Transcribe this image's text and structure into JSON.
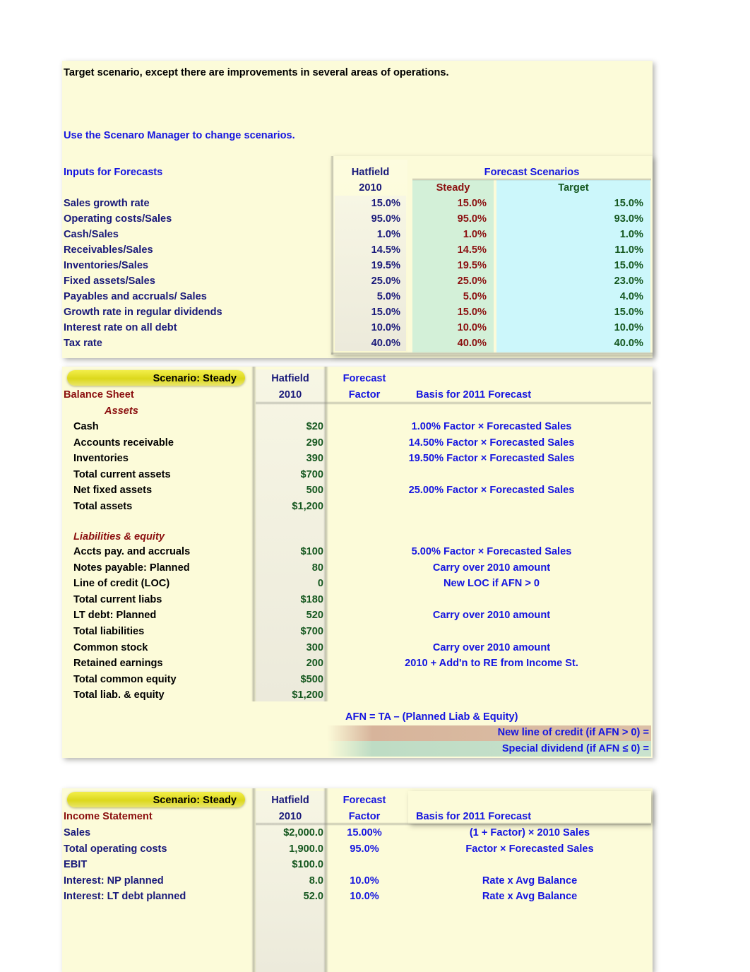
{
  "header": {
    "intro_note": "Target scenario, except there are improvements in several areas of operations.",
    "instruction": "Use the Scenaro Manager to change scenarios."
  },
  "inputs": {
    "title": "Inputs for Forecasts",
    "col_hatfield_line1": "Hatfield",
    "col_hatfield_line2": "2010",
    "group_header": "Forecast Scenarios",
    "col_steady": "Steady",
    "col_target": "Target",
    "rows": [
      {
        "label": "Sales growth rate",
        "hatfield": "15.0%",
        "steady": "15.0%",
        "target": "15.0%"
      },
      {
        "label": "Operating costs/Sales",
        "hatfield": "95.0%",
        "steady": "95.0%",
        "target": "93.0%"
      },
      {
        "label": "Cash/Sales",
        "hatfield": "1.0%",
        "steady": "1.0%",
        "target": "1.0%"
      },
      {
        "label": "Receivables/Sales",
        "hatfield": "14.5%",
        "steady": "14.5%",
        "target": "11.0%"
      },
      {
        "label": "Inventories/Sales",
        "hatfield": "19.5%",
        "steady": "19.5%",
        "target": "15.0%"
      },
      {
        "label": "Fixed assets/Sales",
        "hatfield": "25.0%",
        "steady": "25.0%",
        "target": "23.0%"
      },
      {
        "label": "Payables and accruals/ Sales",
        "hatfield": "5.0%",
        "steady": "5.0%",
        "target": "4.0%"
      },
      {
        "label": "Growth rate in regular dividends",
        "hatfield": "15.0%",
        "steady": "15.0%",
        "target": "15.0%"
      },
      {
        "label": "Interest rate on all debt",
        "hatfield": "10.0%",
        "steady": "10.0%",
        "target": "10.0%"
      },
      {
        "label": "Tax rate",
        "hatfield": "40.0%",
        "steady": "40.0%",
        "target": "40.0%"
      }
    ]
  },
  "balance_sheet": {
    "scenario_tag": "Scenario: Steady",
    "col_hatfield_line1": "Hatfield",
    "col_hatfield_line2": "2010",
    "col_factor_line1": "Forecast",
    "col_factor_line2": "Factor",
    "statement_title": "Balance Sheet",
    "basis_header": "Basis for 2011 Forecast",
    "assets_header": "Assets",
    "liabilities_header": "Liabilities & equity",
    "rows": [
      {
        "label": "Cash",
        "value": "$20",
        "basis": "1.00% Factor × Forecasted Sales"
      },
      {
        "label": "Accounts receivable",
        "value": "290",
        "basis": "14.50% Factor × Forecasted Sales"
      },
      {
        "label": "Inventories",
        "value": "390",
        "basis": "19.50% Factor × Forecasted Sales"
      },
      {
        "label": "Total current assets",
        "value": "$700",
        "basis": ""
      },
      {
        "label": "Net fixed assets",
        "value": "500",
        "basis": "25.00% Factor × Forecasted Sales"
      },
      {
        "label": "Total assets",
        "value": "$1,200",
        "basis": ""
      }
    ],
    "liab_rows": [
      {
        "label": "Accts pay. and accruals",
        "value": "$100",
        "basis": "5.00% Factor × Forecasted Sales"
      },
      {
        "label": "Notes payable: Planned",
        "value": "80",
        "basis": "Carry over 2010 amount"
      },
      {
        "label": "Line of credit (LOC)",
        "value": "0",
        "basis": "New LOC if AFN > 0"
      },
      {
        "label": "Total current liabs",
        "value": "$180",
        "basis": ""
      },
      {
        "label": "LT debt: Planned",
        "value": "520",
        "basis": "Carry over 2010 amount"
      },
      {
        "label": "Total liabilities",
        "value": "$700",
        "basis": ""
      },
      {
        "label": "Common stock",
        "value": "300",
        "basis": "Carry over 2010 amount"
      },
      {
        "label": "Retained earnings",
        "value": "200",
        "basis": "2010 + Add'n to RE from Income St."
      },
      {
        "label": "Total common equity",
        "value": "$500",
        "basis": ""
      },
      {
        "label": "Total liab. & equity",
        "value": "$1,200",
        "basis": ""
      }
    ],
    "afn": {
      "formula": "AFN = TA – (Planned Liab & Equity)",
      "new_loc_label": "New line of credit (if AFN > 0)  =",
      "special_div_label": "Special dividend (if AFN ≤ 0)  ="
    }
  },
  "income_statement": {
    "scenario_tag": "Scenario: Steady",
    "col_hatfield_line1": "Hatfield",
    "col_hatfield_line2": "2010",
    "col_factor_line1": "Forecast",
    "col_factor_line2": "Factor",
    "statement_title": "Income Statement",
    "basis_header": "Basis for 2011 Forecast",
    "rows": [
      {
        "label": "Sales",
        "value": "$2,000.0",
        "factor": "15.00%",
        "basis": "(1 + Factor) × 2010 Sales"
      },
      {
        "label": "Total operating costs",
        "value": "1,900.0",
        "factor": "95.0%",
        "basis": "Factor × Forecasted Sales"
      },
      {
        "label": "EBIT",
        "value": "$100.0",
        "factor": "",
        "basis": ""
      },
      {
        "label": "Interest: NP planned",
        "value": "8.0",
        "factor": "10.0%",
        "basis": "Rate x Avg Balance"
      },
      {
        "label": "Interest: LT debt planned",
        "value": "52.0",
        "factor": "10.0%",
        "basis": "Rate x Avg Balance"
      }
    ]
  },
  "colors": {
    "panel_bg": "#fcfbd9",
    "navy": "#19197a",
    "blue": "#1515e0",
    "dark_red": "#8b1010",
    "dark_green": "#15571f",
    "steady_col_bg": "#d3f0d8",
    "target_col_bg": "#ccf7fb",
    "scenario_tag_bg": "#dcd81c"
  }
}
